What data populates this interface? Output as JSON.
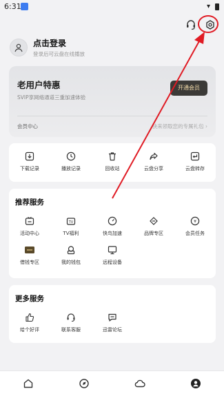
{
  "status": {
    "time": "6:31"
  },
  "user": {
    "name": "点击登录",
    "subtitle": "登录后可云盘在线播放"
  },
  "vip": {
    "title": "老用户特惠",
    "desc": "SVIP享网络通道三重加速体验",
    "button": "开通会员",
    "center": "会员中心",
    "gift": "快来领取您的专属礼包 ›"
  },
  "tools": [
    {
      "label": "下载记录",
      "icon": "download-icon"
    },
    {
      "label": "播放记录",
      "icon": "clock-icon"
    },
    {
      "label": "回收站",
      "icon": "trash-icon"
    },
    {
      "label": "云盘分享",
      "icon": "share-icon"
    },
    {
      "label": "云盘转存",
      "icon": "transfer-icon"
    }
  ],
  "recommended": {
    "title": "推荐服务",
    "items": [
      {
        "label": "活动中心",
        "icon": "tv-activity-icon"
      },
      {
        "label": "TV福利",
        "icon": "tv-icon"
      },
      {
        "label": "快鸟加速",
        "icon": "speed-icon"
      },
      {
        "label": "品牌专区",
        "icon": "brand-icon"
      },
      {
        "label": "会员任务",
        "icon": "task-icon"
      },
      {
        "label": "借钱专区",
        "icon": "loan-icon"
      },
      {
        "label": "我的钱包",
        "icon": "wallet-icon"
      },
      {
        "label": "远程设备",
        "icon": "remote-icon"
      }
    ]
  },
  "more": {
    "title": "更多服务",
    "items": [
      {
        "label": "给个好评",
        "icon": "thumbs-up-icon"
      },
      {
        "label": "联系客服",
        "icon": "headset-icon"
      },
      {
        "label": "迅雷论坛",
        "icon": "forum-icon"
      }
    ]
  },
  "nav": [
    {
      "name": "home-tab",
      "icon": "home-icon"
    },
    {
      "name": "discover-tab",
      "icon": "discover-icon"
    },
    {
      "name": "cloud-tab",
      "icon": "cloud-icon"
    },
    {
      "name": "profile-tab",
      "icon": "profile-icon"
    }
  ],
  "colors": {
    "annotation": "#e01b24",
    "vip_button_bg": "#3b3a37",
    "vip_button_text": "#f0d9a8"
  }
}
